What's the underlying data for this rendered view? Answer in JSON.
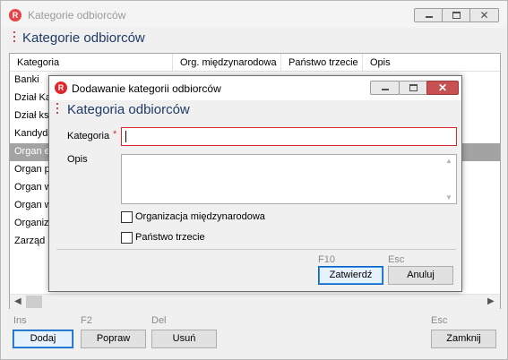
{
  "outer_window": {
    "title": "Kategorie odbiorców",
    "heading": "Kategorie odbiorców",
    "app_icon_letter": "R",
    "close_glyph": "✕"
  },
  "list": {
    "columns": [
      "Kategoria",
      "Org. międzynarodowa",
      "Państwo trzecie",
      "Opis"
    ],
    "rows": [
      "Banki",
      "Dział Ka",
      "Dział ks",
      "Kandyda",
      "Organ e",
      "Organ p",
      "Organ w",
      "Organ w",
      "Organiza",
      "Zarząd"
    ],
    "selected_index": 4
  },
  "toolbar": {
    "add": {
      "shortcut": "Ins",
      "label": "Dodaj"
    },
    "edit": {
      "shortcut": "F2",
      "label": "Popraw"
    },
    "delete": {
      "shortcut": "Del",
      "label": "Usuń"
    },
    "close": {
      "shortcut": "Esc",
      "label": "Zamknij"
    }
  },
  "dialog": {
    "title": "Dodawanie kategorii odbiorców",
    "heading": "Kategoria odbiorców",
    "app_icon_letter": "R",
    "close_glyph": "✕",
    "category_label": "Kategoria",
    "required_mark": "*",
    "category_value": "",
    "description_label": "Opis",
    "description_value": "",
    "checkbox_international": {
      "label": "Organizacja międzynarodowa",
      "checked": false
    },
    "checkbox_third_country": {
      "label": "Państwo trzecie",
      "checked": false
    },
    "confirm": {
      "shortcut": "F10",
      "label": "Zatwierdź"
    },
    "cancel": {
      "shortcut": "Esc",
      "label": "Anuluj"
    }
  },
  "colors": {
    "accent_red": "#e3262c",
    "heading_blue": "#1f3a64",
    "selected_row": "#a3a3a3",
    "error_border": "#d9272e"
  }
}
